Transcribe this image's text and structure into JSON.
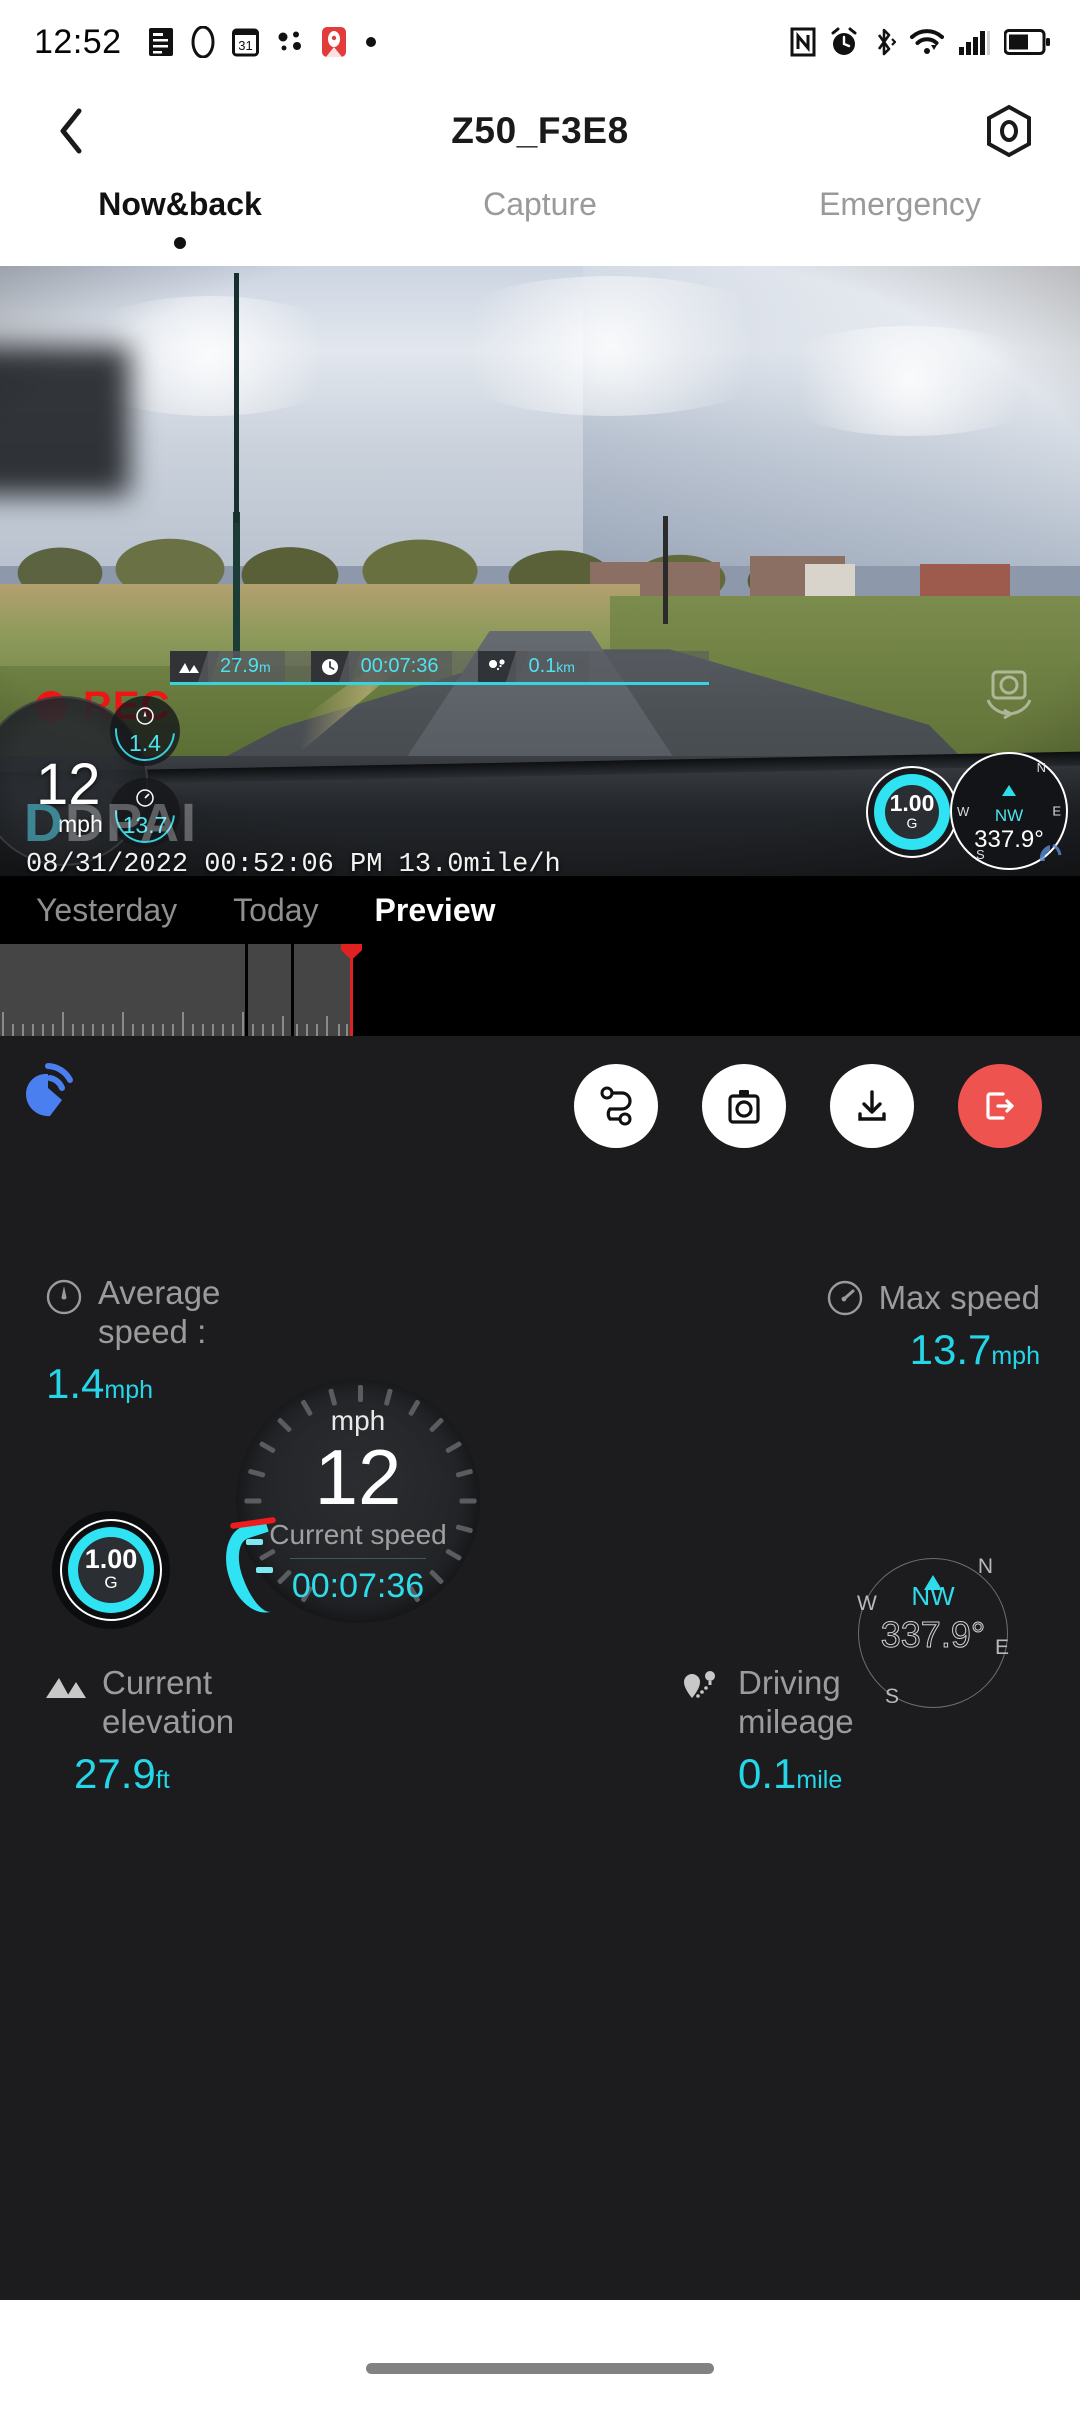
{
  "status_bar": {
    "time": "12:52",
    "left_icons": [
      "news-icon",
      "oval-icon",
      "calendar-31-icon",
      "dots-icon",
      "app-red-icon",
      "dot-icon"
    ],
    "right_icons": [
      "nfc-icon",
      "alarm-icon",
      "bluetooth-icon",
      "wifi-icon",
      "signal-icon",
      "battery-icon"
    ]
  },
  "header": {
    "back_icon": "chevron-left-icon",
    "title": "Z50_F3E8",
    "settings_icon": "hex-settings-icon"
  },
  "tabs": [
    {
      "label": "Now&back",
      "active": true
    },
    {
      "label": "Capture",
      "active": false
    },
    {
      "label": "Emergency",
      "active": false
    }
  ],
  "video": {
    "rec_label": "REC",
    "rec_color": "#ee1515",
    "badges": [
      {
        "icon": "mountain-icon",
        "value": "27.9",
        "unit": "m"
      },
      {
        "icon": "clock-icon",
        "value": "00:07:36",
        "unit": ""
      },
      {
        "icon": "route-pin-icon",
        "value": "0.1",
        "unit": "km"
      }
    ],
    "corner_icon": "camera-rotate-icon",
    "overlay": {
      "speed": "12",
      "speed_unit": "mph",
      "avg_mini": "1.4",
      "max_mini": "13.7",
      "gforce_value": "1.00",
      "gforce_unit": "G",
      "compass_dir": "NW",
      "compass_deg": "337.9°",
      "compass_points": {
        "n": "N",
        "e": "E",
        "s": "S",
        "w": "W"
      },
      "timestamp": "08/31/2022 00:52:06 PM  13.0mile/h",
      "watermark": "DDPAI",
      "gps_icon": "gps-signal-icon"
    }
  },
  "timeline": {
    "tabs": [
      {
        "label": "Yesterday",
        "active": false
      },
      {
        "label": "Today",
        "active": false
      },
      {
        "label": "Preview",
        "active": true
      }
    ],
    "playhead_color": "#e02121"
  },
  "actions": {
    "gesture_icon": "tap-gesture-icon",
    "buttons": [
      {
        "name": "route-button",
        "icon": "route-icon"
      },
      {
        "name": "snapshot-button",
        "icon": "camera-icon"
      },
      {
        "name": "download-button",
        "icon": "download-icon"
      },
      {
        "name": "exit-button",
        "icon": "exit-icon",
        "color": "#ef5350"
      }
    ]
  },
  "stats": {
    "average_speed": {
      "icon": "gauge-icon",
      "label": "Average\nspeed :",
      "label_line1": "Average",
      "label_line2": "speed :",
      "value": "1.4",
      "unit": "mph"
    },
    "max_speed": {
      "icon": "speed-icon",
      "label": "Max speed",
      "value": "13.7",
      "unit": "mph"
    },
    "current_elevation": {
      "icon": "mountain-icon",
      "label_line1": "Current",
      "label_line2": "elevation",
      "value": "27.9",
      "unit": "ft"
    },
    "driving_mileage": {
      "icon": "route-pin-icon",
      "label_line1": "Driving",
      "label_line2": "mileage",
      "value": "0.1",
      "unit": "mile"
    },
    "gforce": {
      "value": "1.00",
      "unit": "G"
    },
    "compass": {
      "dir": "NW",
      "deg": "337.9°",
      "n": "N",
      "e": "E",
      "s": "S",
      "w": "W"
    },
    "speedometer": {
      "unit": "mph",
      "value": "12",
      "caption": "Current speed",
      "elapsed": "00:07:36"
    }
  },
  "nav_bar": {
    "home_indicator": "home-indicator"
  },
  "colors": {
    "accent_cyan": "#2fdcea",
    "rec_red": "#ee1515",
    "exit_red": "#ef5350",
    "panel_bg": "#1c1c1e"
  }
}
